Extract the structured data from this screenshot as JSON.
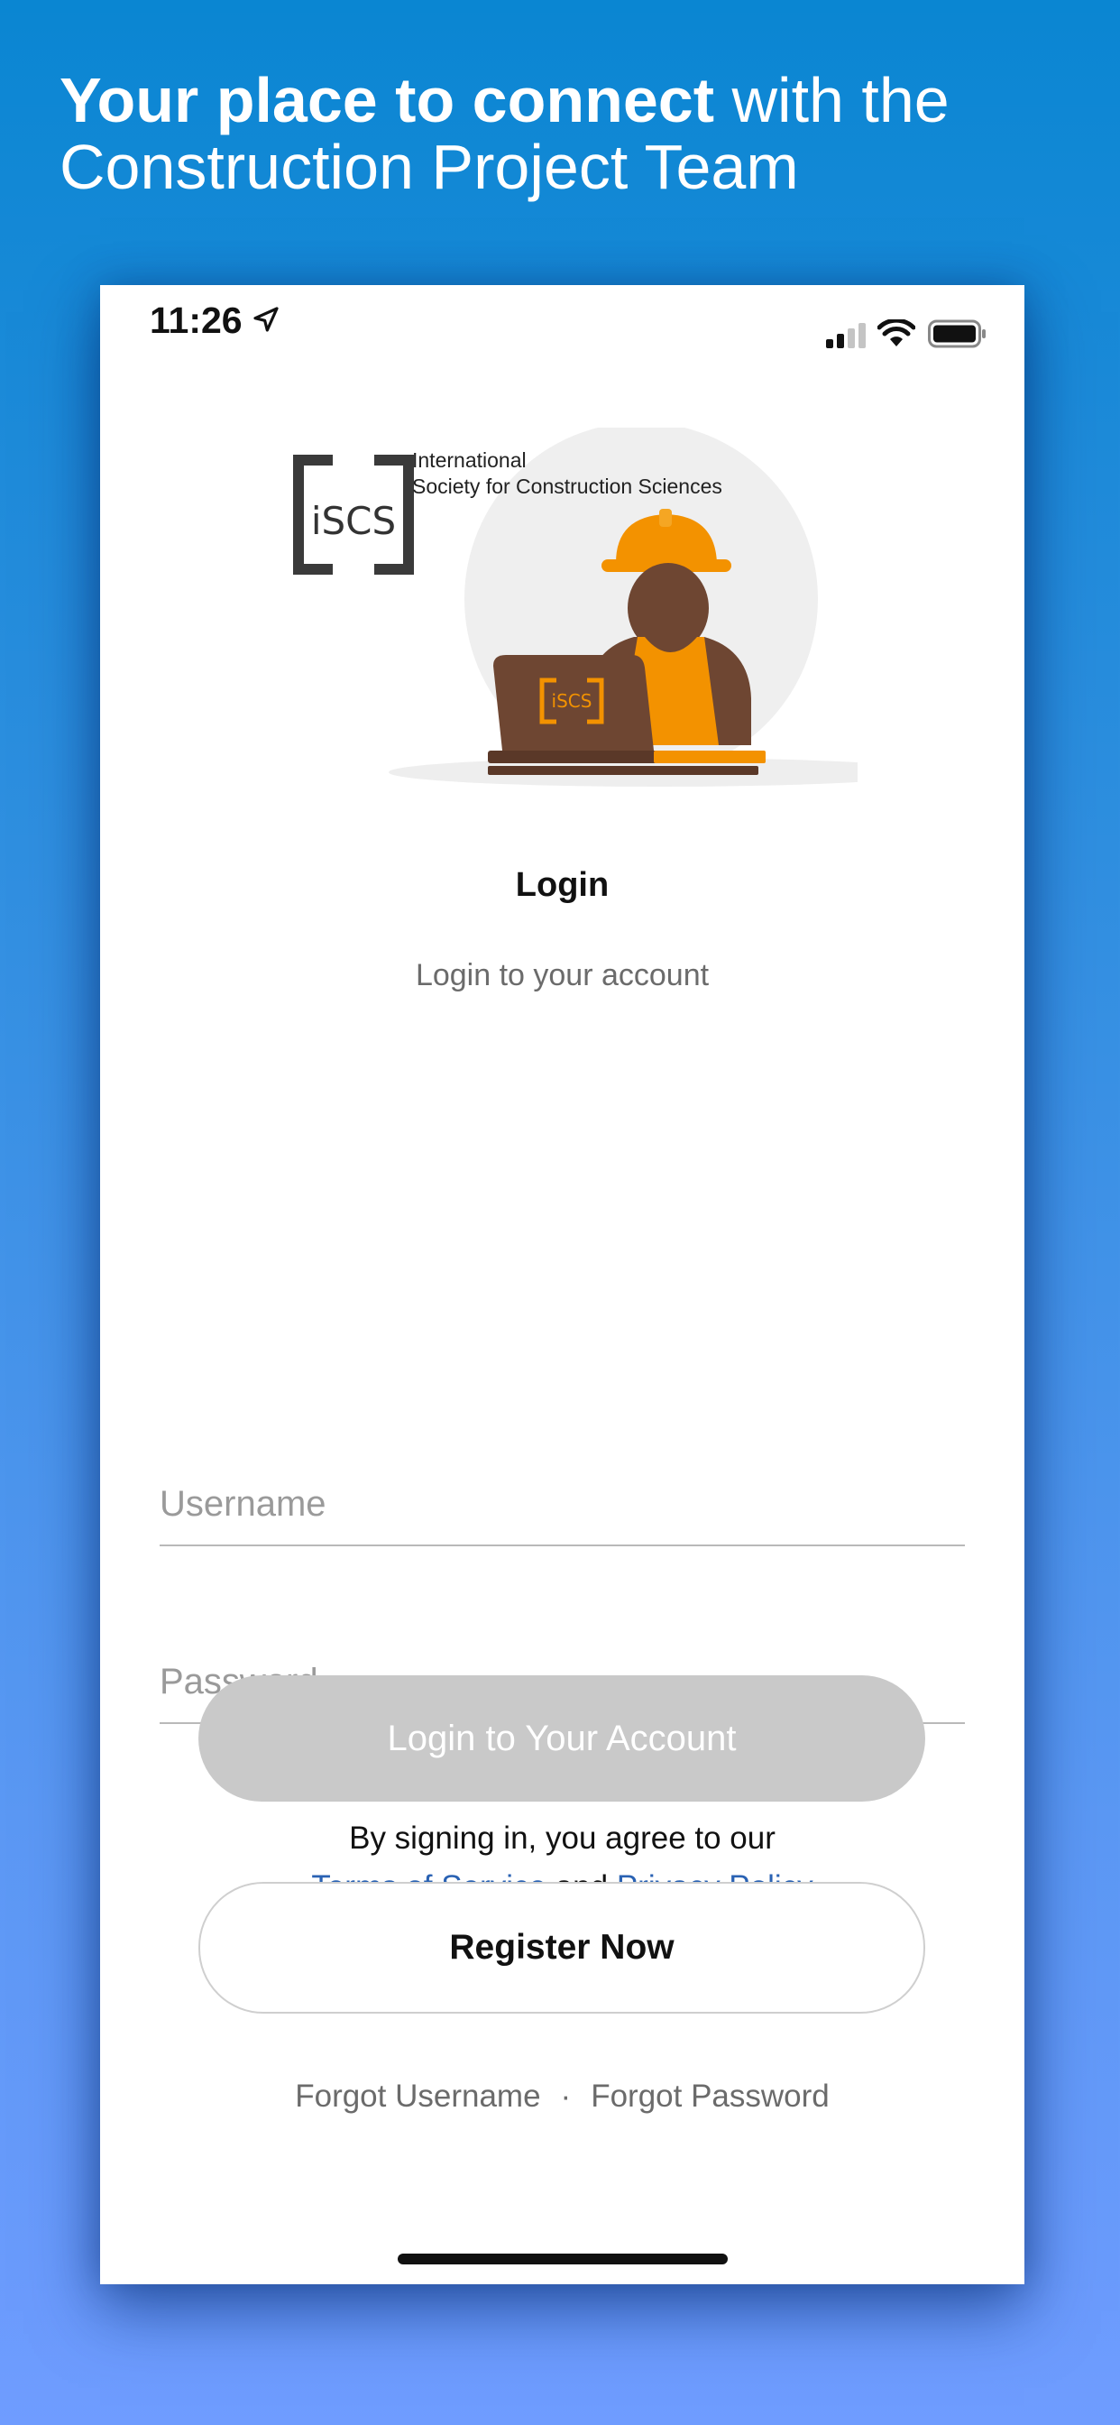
{
  "headline": {
    "bold": "Your place to connect",
    "regular": " with the Construction Project Team"
  },
  "status_bar": {
    "time": "11:26",
    "icons": [
      "location-arrow-icon",
      "cellular-signal-icon",
      "wifi-icon",
      "battery-icon"
    ]
  },
  "logo": {
    "mark": "iSCS",
    "line1": "International",
    "line2": "Society for Construction Sciences",
    "laptop_mark": "iSCS"
  },
  "login": {
    "title": "Login",
    "subtitle": "Login to your account",
    "username_placeholder": "Username",
    "password_placeholder": "Password",
    "agree_prefix": "By signing in, you agree to our",
    "terms_label": "Terms of Service",
    "and_label": "and",
    "privacy_label": "Privacy Policy",
    "login_button": "Login to Your Account",
    "register_button": "Register Now",
    "forgot_username": "Forgot Username",
    "separator": "·",
    "forgot_password": "Forgot Password"
  },
  "colors": {
    "background_top": "#0a86d2",
    "background_bottom": "#6f9cff",
    "link": "#2a62b3",
    "disabled_button": "#c9c9c9",
    "orange": "#f39200",
    "brown": "#6e4632"
  }
}
